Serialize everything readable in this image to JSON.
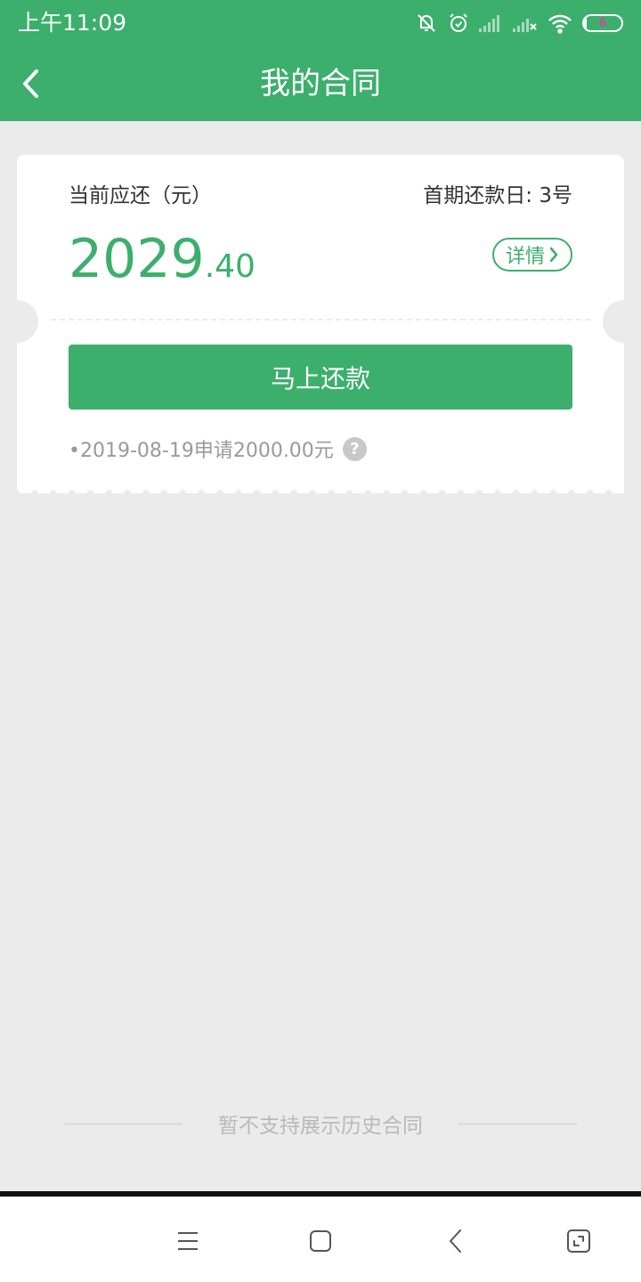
{
  "status_bar": {
    "time": "上午11:09",
    "icons": [
      "mute-icon",
      "alarm-icon",
      "signal-icon",
      "signal-no-service-icon",
      "wifi-icon",
      "battery-icon"
    ],
    "battery_level": "6"
  },
  "header": {
    "title": "我的合同",
    "back_icon": "back-arrow-icon"
  },
  "contract": {
    "due_label": "当前应还（元）",
    "first_repayment_day": "首期还款日: 3号",
    "amount_integer": "2029",
    "amount_decimal": ".40",
    "detail_label": "详情",
    "repay_button": "马上还款",
    "apply_info": "•2019-08-19申请2000.00元",
    "help_icon": "?"
  },
  "history_notice": "暂不支持展示历史合同",
  "system_nav": [
    "menu-icon",
    "home-icon",
    "back-icon",
    "screenshot-icon"
  ],
  "colors": {
    "brand": "#3caf6d",
    "background": "#ebebeb",
    "muted_text": "#9a9a9a"
  }
}
